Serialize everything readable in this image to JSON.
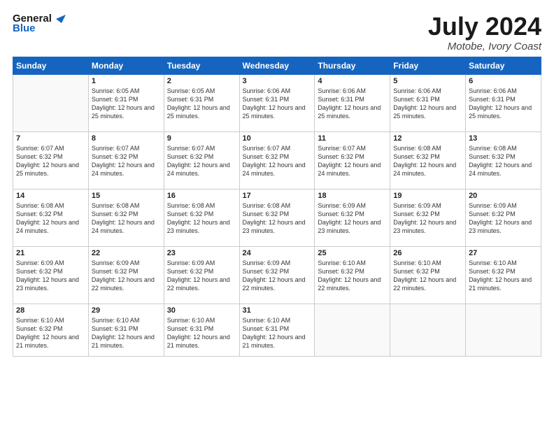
{
  "header": {
    "logo_line1": "General",
    "logo_line2": "Blue",
    "month": "July 2024",
    "location": "Motobe, Ivory Coast"
  },
  "days_of_week": [
    "Sunday",
    "Monday",
    "Tuesday",
    "Wednesday",
    "Thursday",
    "Friday",
    "Saturday"
  ],
  "weeks": [
    [
      {
        "day": "",
        "info": ""
      },
      {
        "day": "1",
        "info": "Sunrise: 6:05 AM\nSunset: 6:31 PM\nDaylight: 12 hours\nand 25 minutes."
      },
      {
        "day": "2",
        "info": "Sunrise: 6:05 AM\nSunset: 6:31 PM\nDaylight: 12 hours\nand 25 minutes."
      },
      {
        "day": "3",
        "info": "Sunrise: 6:06 AM\nSunset: 6:31 PM\nDaylight: 12 hours\nand 25 minutes."
      },
      {
        "day": "4",
        "info": "Sunrise: 6:06 AM\nSunset: 6:31 PM\nDaylight: 12 hours\nand 25 minutes."
      },
      {
        "day": "5",
        "info": "Sunrise: 6:06 AM\nSunset: 6:31 PM\nDaylight: 12 hours\nand 25 minutes."
      },
      {
        "day": "6",
        "info": "Sunrise: 6:06 AM\nSunset: 6:31 PM\nDaylight: 12 hours\nand 25 minutes."
      }
    ],
    [
      {
        "day": "7",
        "info": "Sunrise: 6:07 AM\nSunset: 6:32 PM\nDaylight: 12 hours\nand 25 minutes."
      },
      {
        "day": "8",
        "info": "Sunrise: 6:07 AM\nSunset: 6:32 PM\nDaylight: 12 hours\nand 24 minutes."
      },
      {
        "day": "9",
        "info": "Sunrise: 6:07 AM\nSunset: 6:32 PM\nDaylight: 12 hours\nand 24 minutes."
      },
      {
        "day": "10",
        "info": "Sunrise: 6:07 AM\nSunset: 6:32 PM\nDaylight: 12 hours\nand 24 minutes."
      },
      {
        "day": "11",
        "info": "Sunrise: 6:07 AM\nSunset: 6:32 PM\nDaylight: 12 hours\nand 24 minutes."
      },
      {
        "day": "12",
        "info": "Sunrise: 6:08 AM\nSunset: 6:32 PM\nDaylight: 12 hours\nand 24 minutes."
      },
      {
        "day": "13",
        "info": "Sunrise: 6:08 AM\nSunset: 6:32 PM\nDaylight: 12 hours\nand 24 minutes."
      }
    ],
    [
      {
        "day": "14",
        "info": "Sunrise: 6:08 AM\nSunset: 6:32 PM\nDaylight: 12 hours\nand 24 minutes."
      },
      {
        "day": "15",
        "info": "Sunrise: 6:08 AM\nSunset: 6:32 PM\nDaylight: 12 hours\nand 24 minutes."
      },
      {
        "day": "16",
        "info": "Sunrise: 6:08 AM\nSunset: 6:32 PM\nDaylight: 12 hours\nand 23 minutes."
      },
      {
        "day": "17",
        "info": "Sunrise: 6:08 AM\nSunset: 6:32 PM\nDaylight: 12 hours\nand 23 minutes."
      },
      {
        "day": "18",
        "info": "Sunrise: 6:09 AM\nSunset: 6:32 PM\nDaylight: 12 hours\nand 23 minutes."
      },
      {
        "day": "19",
        "info": "Sunrise: 6:09 AM\nSunset: 6:32 PM\nDaylight: 12 hours\nand 23 minutes."
      },
      {
        "day": "20",
        "info": "Sunrise: 6:09 AM\nSunset: 6:32 PM\nDaylight: 12 hours\nand 23 minutes."
      }
    ],
    [
      {
        "day": "21",
        "info": "Sunrise: 6:09 AM\nSunset: 6:32 PM\nDaylight: 12 hours\nand 23 minutes."
      },
      {
        "day": "22",
        "info": "Sunrise: 6:09 AM\nSunset: 6:32 PM\nDaylight: 12 hours\nand 22 minutes."
      },
      {
        "day": "23",
        "info": "Sunrise: 6:09 AM\nSunset: 6:32 PM\nDaylight: 12 hours\nand 22 minutes."
      },
      {
        "day": "24",
        "info": "Sunrise: 6:09 AM\nSunset: 6:32 PM\nDaylight: 12 hours\nand 22 minutes."
      },
      {
        "day": "25",
        "info": "Sunrise: 6:10 AM\nSunset: 6:32 PM\nDaylight: 12 hours\nand 22 minutes."
      },
      {
        "day": "26",
        "info": "Sunrise: 6:10 AM\nSunset: 6:32 PM\nDaylight: 12 hours\nand 22 minutes."
      },
      {
        "day": "27",
        "info": "Sunrise: 6:10 AM\nSunset: 6:32 PM\nDaylight: 12 hours\nand 21 minutes."
      }
    ],
    [
      {
        "day": "28",
        "info": "Sunrise: 6:10 AM\nSunset: 6:32 PM\nDaylight: 12 hours\nand 21 minutes."
      },
      {
        "day": "29",
        "info": "Sunrise: 6:10 AM\nSunset: 6:31 PM\nDaylight: 12 hours\nand 21 minutes."
      },
      {
        "day": "30",
        "info": "Sunrise: 6:10 AM\nSunset: 6:31 PM\nDaylight: 12 hours\nand 21 minutes."
      },
      {
        "day": "31",
        "info": "Sunrise: 6:10 AM\nSunset: 6:31 PM\nDaylight: 12 hours\nand 21 minutes."
      },
      {
        "day": "",
        "info": ""
      },
      {
        "day": "",
        "info": ""
      },
      {
        "day": "",
        "info": ""
      }
    ]
  ]
}
